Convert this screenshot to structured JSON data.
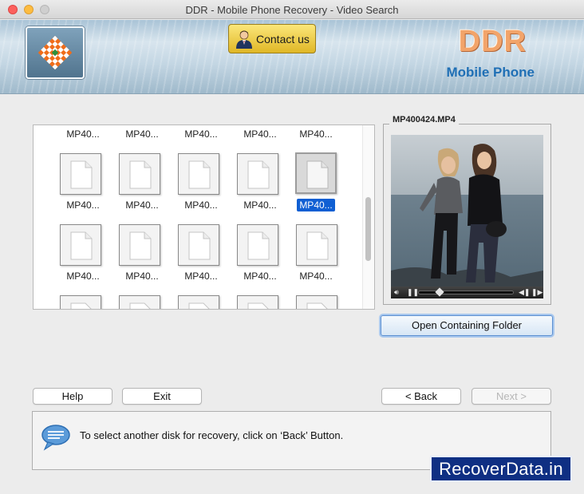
{
  "window": {
    "title": "DDR - Mobile Phone Recovery - Video Search"
  },
  "header": {
    "contact_label": "Contact us",
    "brand_name": "DDR",
    "brand_subtitle": "Mobile Phone"
  },
  "thumbnails": {
    "rows": [
      {
        "labels": [
          "MP40...",
          "MP40...",
          "MP40...",
          "MP40...",
          "MP40..."
        ]
      },
      {
        "labels": [
          "MP40...",
          "MP40...",
          "MP40...",
          "MP40...",
          "MP40..."
        ]
      },
      {
        "labels": [
          "MP40...",
          "MP40...",
          "MP40...",
          "MP40...",
          "MP40..."
        ]
      }
    ],
    "selected": {
      "row": 1,
      "col": 4
    }
  },
  "preview": {
    "title": "MP400424.MP4",
    "progress": 0.2
  },
  "buttons": {
    "open_folder": "Open Containing Folder",
    "help": "Help",
    "exit": "Exit",
    "back": "< Back",
    "next": "Next >"
  },
  "status": {
    "message": "To select another disk for recovery, click on ‘Back’ Button."
  },
  "watermark": "RecoverData.in",
  "colors": {
    "accent": "#0f5fd3",
    "brand_orange": "#f2a46a",
    "brand_blue": "#1f6fb5",
    "contact_gold": "#f0cf4a"
  }
}
